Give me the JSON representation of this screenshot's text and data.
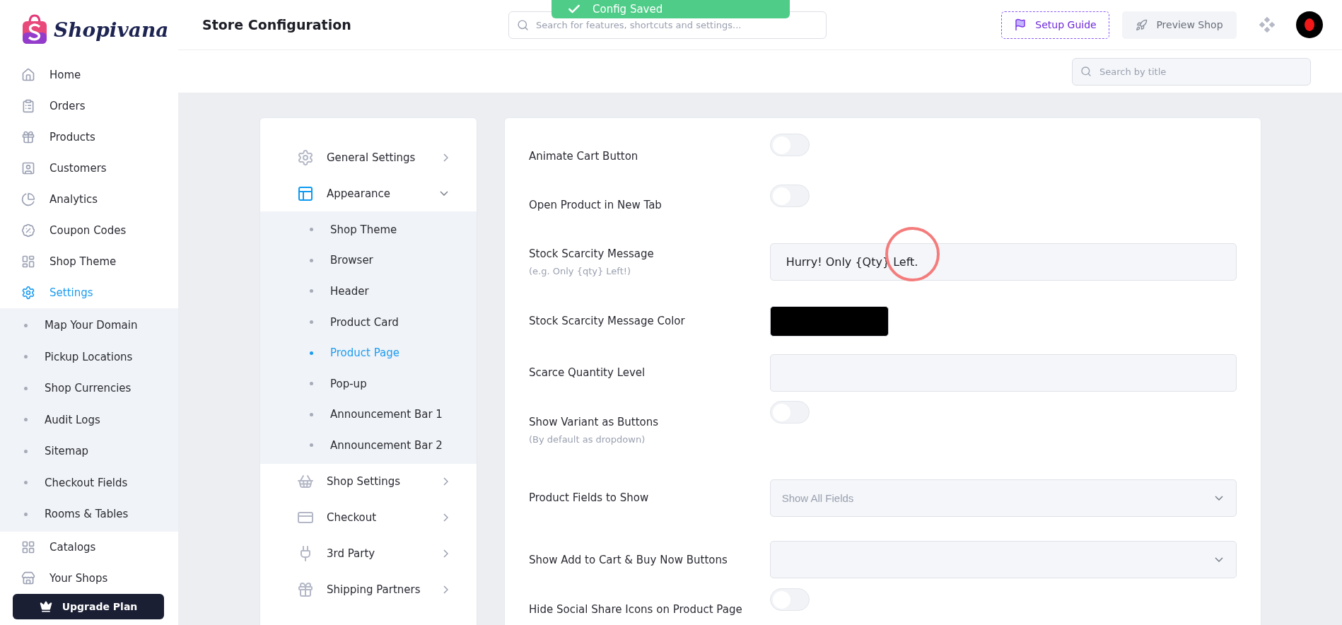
{
  "brand": {
    "name": "Shopivana"
  },
  "header": {
    "title": "Store Configuration",
    "search_placeholder": "Search for features, shortcuts and settings...",
    "setup_guide": "Setup Guide",
    "preview_shop": "Preview Shop"
  },
  "toast": {
    "message": "Config Saved"
  },
  "sidebar": {
    "items": [
      {
        "label": "Home",
        "selected": false
      },
      {
        "label": "Orders",
        "selected": false
      },
      {
        "label": "Products",
        "selected": false
      },
      {
        "label": "Customers",
        "selected": false
      },
      {
        "label": "Analytics",
        "selected": false
      },
      {
        "label": "Coupon Codes",
        "selected": false
      },
      {
        "label": "Shop Theme",
        "selected": false
      },
      {
        "label": "Settings",
        "selected": true,
        "expanded": true,
        "children": [
          {
            "label": "Map Your Domain"
          },
          {
            "label": "Pickup Locations"
          },
          {
            "label": "Shop Currencies"
          },
          {
            "label": "Audit Logs"
          },
          {
            "label": "Sitemap"
          },
          {
            "label": "Checkout Fields"
          },
          {
            "label": "Rooms & Tables"
          }
        ]
      },
      {
        "label": "Catalogs",
        "selected": false
      },
      {
        "label": "Your Shops",
        "selected": false
      }
    ],
    "upgrade": "Upgrade Plan"
  },
  "subbar": {
    "search_placeholder": "Search by title"
  },
  "settings_nav": [
    {
      "label": "General Settings",
      "expanded": false
    },
    {
      "label": "Appearance",
      "expanded": true,
      "children": [
        {
          "label": "Shop Theme",
          "selected": false
        },
        {
          "label": "Browser",
          "selected": false
        },
        {
          "label": "Header",
          "selected": false
        },
        {
          "label": "Product Card",
          "selected": false
        },
        {
          "label": "Product Page",
          "selected": true
        },
        {
          "label": "Pop-up",
          "selected": false
        },
        {
          "label": "Announcement Bar 1",
          "selected": false
        },
        {
          "label": "Announcement Bar 2",
          "selected": false
        }
      ]
    },
    {
      "label": "Shop Settings",
      "expanded": false
    },
    {
      "label": "Checkout",
      "expanded": false
    },
    {
      "label": "3rd Party",
      "expanded": false
    },
    {
      "label": "Shipping Partners",
      "expanded": false
    }
  ],
  "form": [
    {
      "kind": "toggle",
      "label": "Animate Cart Button",
      "on": false
    },
    {
      "kind": "toggle",
      "label": "Open Product in New Tab",
      "on": false
    },
    {
      "kind": "text",
      "label": "Stock Scarcity Message",
      "hint": "(e.g. Only {qty} Left!)",
      "value": "Hurry! Only {Qty} Left."
    },
    {
      "kind": "color",
      "label": "Stock Scarcity Message Color",
      "color": "#000000"
    },
    {
      "kind": "text",
      "label": "Scarce Quantity Level"
    },
    {
      "kind": "toggle",
      "label": "Show Variant as Buttons",
      "hint": "(By default as dropdown)",
      "on": false
    },
    {
      "kind": "select",
      "label": "Product Fields to Show",
      "placeholder": "Show All Fields"
    },
    {
      "kind": "select",
      "label": "Show Add to Cart & Buy Now Buttons"
    },
    {
      "kind": "toggle",
      "label": "Hide Social Share Icons on Product Page",
      "on": false
    }
  ]
}
